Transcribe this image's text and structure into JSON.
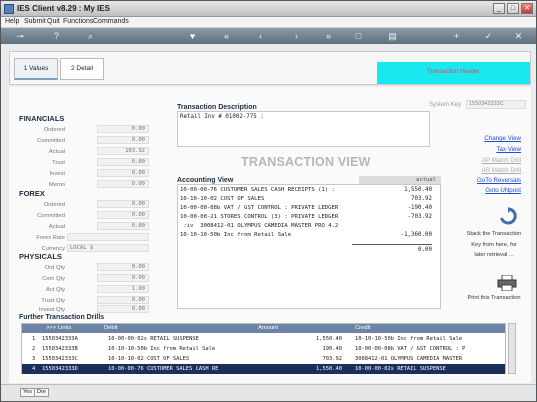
{
  "window": {
    "title": "IES Client v8.29 : My IES"
  },
  "menu": [
    "Help",
    "Submit",
    "Quit",
    "Functions",
    "Commands"
  ],
  "toolbar_icons": [
    "key-icon",
    "help-icon",
    "search-icon",
    "heart-icon",
    "first-icon",
    "prev-icon",
    "next-icon",
    "last-icon",
    "new-doc-icon",
    "print-icon",
    "add-icon",
    "check-icon",
    "close-icon"
  ],
  "tabs": [
    {
      "label": "1 Values"
    },
    {
      "label": "2 Detail"
    }
  ],
  "banner": {
    "text": "Transaction Header"
  },
  "financials": {
    "title": "FINANCIALS",
    "rows": [
      {
        "label": "Ordered",
        "value": "0.00"
      },
      {
        "label": "Committed",
        "value": "0.00"
      },
      {
        "label": "Actual",
        "value": "103.92"
      },
      {
        "label": "Trust",
        "value": "0.00"
      },
      {
        "label": "Invest",
        "value": "0.00"
      },
      {
        "label": "Memo",
        "value": "0.00"
      }
    ]
  },
  "forex": {
    "title": "FOREX",
    "rows": [
      {
        "label": "Ordered",
        "value": "0.00"
      },
      {
        "label": "Committed",
        "value": "0.00"
      },
      {
        "label": "Actual",
        "value": "0.00"
      },
      {
        "label": "Forex Rate",
        "value": ""
      },
      {
        "label": "Currency",
        "value": "LOCAL $"
      }
    ]
  },
  "physicals": {
    "title": "PHYSICALS",
    "rows": [
      {
        "label": "Ord Qty",
        "value": "0.00"
      },
      {
        "label": "Com Qty",
        "value": "0.00"
      },
      {
        "label": "Act Qty",
        "value": "1.00"
      },
      {
        "label": "Trust Qty",
        "value": "0.00"
      },
      {
        "label": "Invest Qty",
        "value": "0.00"
      }
    ]
  },
  "transaction": {
    "description_label": "Transaction Description",
    "description": "Retail Inv # 01002-775 :",
    "system_key_label": "System Key",
    "system_key": "1550342333C",
    "view_title": "TRANSACTION VIEW"
  },
  "accounting": {
    "title": "Accounting View",
    "column_header": "actual",
    "rows": [
      {
        "text": "10-00-00-76 CUSTOMER SALES CASH RECEIPTS (1) :",
        "amount": "1,550.40"
      },
      {
        "text": "10-10-10-02 COST OF SALES",
        "amount": "703.92"
      },
      {
        "text": "10-00-00-08b VAT / GST CONTROL : PRIVATE LEDGER",
        "amount": "-190.40"
      },
      {
        "text": "10-00-00-21 STORES CONTROL (3) : PRIVATE LEDGER",
        "amount": "-703.92"
      },
      {
        "text": " :iv  3008412-01 OLYMPUS CAMEDIA MASTER PRO 4.2",
        "amount": ""
      },
      {
        "text": "10-10-10-50b Inc from Retail Sale",
        "amount": "-1,360.00"
      }
    ],
    "total": "0.00"
  },
  "side_links": [
    {
      "label": "Change View",
      "enabled": true
    },
    {
      "label": "Tax View",
      "enabled": true
    },
    {
      "label": "AP Match Drill",
      "enabled": false
    },
    {
      "label": "AR Match Drill",
      "enabled": false
    },
    {
      "label": "GoTo Reversals",
      "enabled": true
    },
    {
      "label": "Goto UNpost",
      "enabled": true
    }
  ],
  "side_actions": {
    "stack_text_1": "Stack the Transaction",
    "stack_text_2": "Key from here, for",
    "stack_text_3": "later retrieval ...",
    "print_text": "Print this Transaction"
  },
  "drills": {
    "title": "Further Transaction Drills",
    "headers": {
      "links": ">>> Links",
      "debit": "Debit",
      "amount": "Amount",
      "credit": "Credit"
    },
    "rows": [
      {
        "num": "1",
        "link": "1550342333A",
        "debit": "10-00-00-02s RETAIL SUSPENSE",
        "amount": "1,550.40",
        "credit": "10-10-10-50b Inc from Retail Sale"
      },
      {
        "num": "2",
        "link": "1550342333B",
        "debit": "10-10-10-50b Inc from Retail Sale",
        "amount": "190.40",
        "credit": "10-00-00-08b VAT / GST CONTROL : P"
      },
      {
        "num": "3",
        "link": "1550342333C",
        "debit": "10-10-10-02 COST OF SALES",
        "amount": "703.92",
        "credit": "3008412-01 OLYMPUS CAMEDIA MASTER"
      },
      {
        "num": "4",
        "link": "1550342333D",
        "debit": "10-00-00-76 CUSTOMER SALES CASH RE",
        "amount": "1,550.40",
        "credit": "10-00-00-02s RETAIL SUSPENSE"
      }
    ]
  },
  "status": {
    "btn1": "Yes",
    "btn2": "Dre"
  }
}
